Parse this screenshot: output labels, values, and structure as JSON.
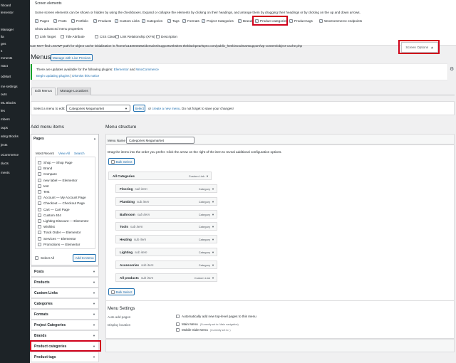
{
  "sidebar": {
    "items": [
      "hboard",
      "lementor",
      "",
      "Manager",
      "lia",
      "ges",
      "s",
      "mments",
      "ntact",
      "",
      "odMart",
      "me settings",
      "outs",
      "ML Blocks",
      "les",
      "mbers",
      "oups",
      "ating Blocks",
      "jects",
      "oCommerce",
      "ducts",
      "ments"
    ]
  },
  "screen_options": {
    "heading": "Screen elements",
    "description": "Some screen elements can be shown or hidden by using the checkboxes. Expand or collapse the elements by clicking on their headings, and arrange them by dragging their headings or by clicking on the up and down arrows.",
    "boxes": [
      {
        "label": "Pages",
        "checked": true
      },
      {
        "label": "Posts",
        "checked": true
      },
      {
        "label": "Portfolio",
        "checked": true
      },
      {
        "label": "Products",
        "checked": true
      },
      {
        "label": "Custom Links",
        "checked": true
      },
      {
        "label": "Categories",
        "checked": true
      },
      {
        "label": "Tags",
        "checked": true
      },
      {
        "label": "Formats",
        "checked": true
      },
      {
        "label": "Project Categories",
        "checked": true
      },
      {
        "label": "Brands",
        "checked": true
      },
      {
        "label": "Product categories",
        "checked": true
      },
      {
        "label": "Product tags",
        "checked": true
      },
      {
        "label": "WooCommerce endpoints",
        "checked": true
      }
    ],
    "advanced_heading": "Show advanced menu properties",
    "advanced": [
      {
        "label": "Link Target",
        "checked": false
      },
      {
        "label": "Title Attribute",
        "checked": false
      },
      {
        "label": "CSS Classes",
        "checked": false
      },
      {
        "label": "Link Relationship (XFN)",
        "checked": false
      },
      {
        "label": "Description",
        "checked": false
      }
    ],
    "cache_notice": "Can NOT find LSCWP path for object cache initialization in /home/u133040262/domains/supportwebsites.theblackpearlspro.com/public_html/woodmartsupport/wp-content/object-cache.php",
    "toggle_label": "Screen Options",
    "toggle_arrow": "▲"
  },
  "header": {
    "title": "Menus",
    "manage_live": "Manage with Live Preview"
  },
  "notice": {
    "text_prefix": "There are updates available for the following plugins:",
    "plugin1": "Elementor",
    "and": "and",
    "plugin2": "WooCommerce",
    "begin_link": "Begin updating plugins",
    "separator": "|",
    "dismiss_link": "Dismiss this notice"
  },
  "tabs": [
    "Edit Menus",
    "Manage Locations"
  ],
  "select_bar": {
    "label": "Select a menu to edit:",
    "value": "Categories Megamarket",
    "select_btn": "Select",
    "or": "or",
    "create_link": "create a new menu",
    "after": ". Do not forget to save your changes!"
  },
  "add_items": {
    "heading": "Add menu items",
    "pages_title": "Pages",
    "tabs": [
      "Most Recent",
      "View All",
      "Search"
    ],
    "pages": [
      "Shop — Shop Page",
      "Brand",
      "Compare",
      "new label — Elementor",
      "test",
      "Test",
      "Account — My Account Page",
      "Checkout — Checkout Page",
      "Cart — Cart Page",
      "Custom 404",
      "Lighting Discount — Elementor",
      "Wishlist",
      "Track Order — Elementor",
      "Services — Elementor",
      "Promotions — Elementor"
    ],
    "select_all": "Select All",
    "add_button": "Add to Menu",
    "sections": [
      "Posts",
      "Products",
      "Custom Links",
      "Categories",
      "Formats",
      "Project Categories",
      "Brands",
      "Product categories",
      "Product tags"
    ]
  },
  "structure": {
    "heading": "Menu structure",
    "name_label": "Menu Name",
    "name_value": "Categories Megamarket",
    "instructions": "Drag the items into the order you prefer. Click the arrow on the right of the item to reveal additional configuration options.",
    "bulk_select": "Bulk Select",
    "top_item": {
      "title": "All Categories",
      "type": "Custom Link"
    },
    "sub_label": "sub item",
    "items": [
      {
        "title": "Flooring",
        "type": "Category"
      },
      {
        "title": "Plumbing",
        "type": "Category"
      },
      {
        "title": "Bathroom",
        "type": "Category"
      },
      {
        "title": "Tools",
        "type": "Category"
      },
      {
        "title": "Heating",
        "type": "Category"
      },
      {
        "title": "Lighting",
        "type": "Category"
      },
      {
        "title": "Accessories",
        "type": "Category"
      },
      {
        "title": "All products",
        "type": "Custom Link"
      }
    ]
  },
  "settings": {
    "heading": "Menu Settings",
    "auto_label": "Auto add pages",
    "auto_text": "Automatically add new top-level pages to this menu",
    "display_label": "Display location",
    "locations": [
      {
        "name": "Main Menu",
        "note": "(Currently set to: Main navigation)"
      },
      {
        "name": "Mobile Side Menu",
        "note": "(Currently set to: )"
      }
    ]
  },
  "icons": {
    "arrow": "▼",
    "check": "✓",
    "gear": "⚙"
  }
}
